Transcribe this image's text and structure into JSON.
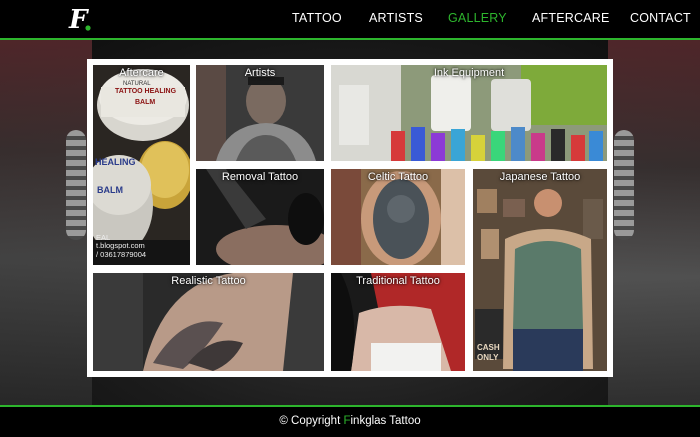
{
  "header": {
    "logo_letter": "F",
    "nav": [
      {
        "label": "TATTOO",
        "active": false
      },
      {
        "label": "ARTISTS",
        "active": false
      },
      {
        "label": "GALLERY",
        "active": true
      },
      {
        "label": "AFTERCARE",
        "active": false
      },
      {
        "label": "CONTACT",
        "active": false
      }
    ]
  },
  "gallery": {
    "tiles": [
      {
        "caption": "Aftercare",
        "overlay_lines": [
          "NATURAL",
          "TATTOO HEALING",
          "BALM",
          "HEALING",
          "BALM",
          "EAL",
          "t.blogspot.com",
          "/ 03617879004"
        ]
      },
      {
        "caption": "Artists"
      },
      {
        "caption": "Ink Equipment"
      },
      {
        "caption": "Removal Tattoo"
      },
      {
        "caption": "Celtic Tattoo"
      },
      {
        "caption": "Japanese Tattoo",
        "overlay_lines": [
          "CASH",
          "ONLY"
        ]
      },
      {
        "caption": "Realistic Tattoo"
      },
      {
        "caption": "Traditional Tattoo"
      }
    ]
  },
  "footer": {
    "copyright_prefix": "© Copyright ",
    "brand_highlight": "F",
    "brand_rest": "inkglas Tattoo"
  },
  "colors": {
    "accent": "#2db52d",
    "header_bg": "#000000",
    "frame": "#ffffff"
  }
}
